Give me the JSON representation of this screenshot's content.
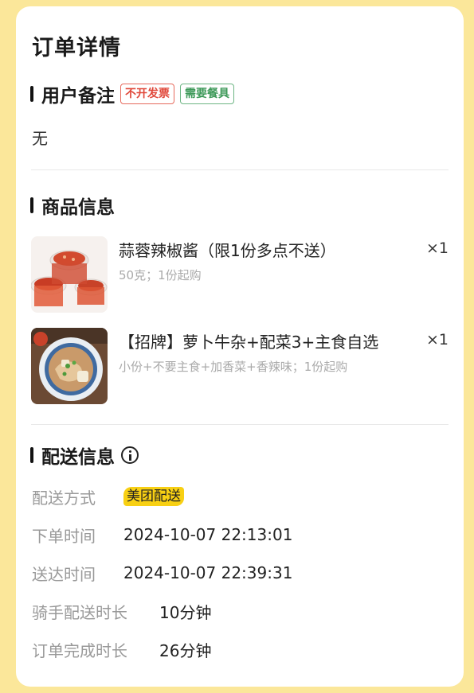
{
  "header": {
    "title": "订单详情"
  },
  "remark": {
    "title": "用户备注",
    "tags": [
      "不开发票",
      "需要餐具"
    ],
    "text": "无"
  },
  "goods": {
    "title": "商品信息",
    "items": [
      {
        "name": "蒜蓉辣椒酱（限1份多点不送）",
        "spec": "50克；1份起购",
        "qty": "×1",
        "image_icon": "chili-sauce-cups-image"
      },
      {
        "name": "【招牌】萝卜牛杂+配菜3+主食自选",
        "spec": "小份+不要主食+加香菜+香辣味；1份起购",
        "qty": "×1",
        "image_icon": "beef-offal-bowl-image"
      }
    ]
  },
  "delivery": {
    "title": "配送信息",
    "rows": [
      {
        "label": "配送方式",
        "value": "美团配送"
      },
      {
        "label": "下单时间",
        "value": "2024-10-07 22:13:01"
      },
      {
        "label": "送达时间",
        "value": "2024-10-07 22:39:31"
      },
      {
        "label": "骑手配送时长",
        "value": "10分钟"
      },
      {
        "label": "订单完成时长",
        "value": "26分钟"
      }
    ]
  },
  "colors": {
    "background": "#fbe79a",
    "badge": "#f8d013",
    "tag_red": "#e0483a",
    "tag_green": "#3f9a5a"
  }
}
